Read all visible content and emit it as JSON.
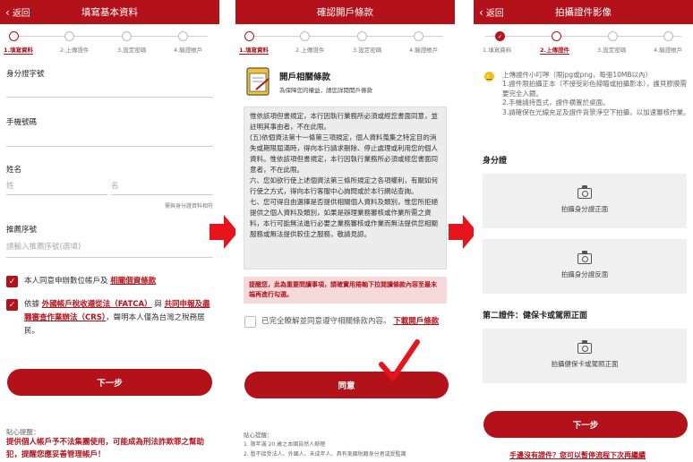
{
  "steps": [
    "1.填寫資料",
    "2.上傳證件",
    "3.設定密碼",
    "4.驗證帳戶"
  ],
  "p1": {
    "back": "返回",
    "title": "填寫基本資料",
    "id_label": "身分證字號",
    "phone_label": "手機號碼",
    "name_label": "姓名",
    "surname_ph": "姓",
    "given_ph": "名",
    "name_note": "需與身分證資料相符",
    "referral_label": "推薦序號",
    "referral_ph": "請輸入推薦序號(選填)",
    "agree1_text": "本人同意申辦數位帳戶及",
    "agree1_link": "相關個資條款",
    "agree2_pre": "依據",
    "agree2_link1": "外國帳戶稅收遵從法（FATCA）",
    "agree2_mid": "與",
    "agree2_link2": "共同申報及盡職審查作業辦法（CRS）",
    "agree2_post": "，聲明本人僅為台灣之稅務居民。",
    "next": "下一步",
    "tip_title": "貼心提醒：",
    "tip_text": "提供個人帳戶予不法集團使用，可能成為刑法詐欺罪之幫助犯，提醒您應妥善管理帳戶！"
  },
  "p2": {
    "title": "確認開戶條款",
    "section_title": "開戶相關條款",
    "section_sub": "為保障您的權益，請您詳閱開戶條款",
    "terms": "惟依該項但書規定，本行因執行業務所必須或經您書面同意，並註明其事由者，不在此限。\n(五)依個資法第十一條第三項規定，個人資料蒐集之特定目的消失或期限屆滿時，得向本行請求刪除、停止處理或利用您的個人資料。惟依該項但書規定，本行因執行業務所必須或經您書面同意者，不在此限。\n六、您如欲行使上述個資法第三條所規定之各項權利，有關如何行使之方式，得向本行客服中心詢問或於本行網站查詢。\n七、您可得自由選擇是否提供相關個人資料及類別，惟您所拒絕提供之個人資料及類別，如果是辦理業務審核或作業所需之資料，本行可能無法進行必要之業務審核或作業而無法提供您相關服務或無法提供較佳之服務，敬請見諒。",
    "warning": "提醒您，此為重要問讀事項，請確實用捲軸下拉閱讀條款內容至最末端再進行勾選。",
    "agree_text": "已完全瞭解並同意遵守相關條款內容。",
    "agree_link": "下載開戶條款",
    "agree_btn": "同意",
    "tip_title": "貼心提醒：",
    "tip1": "1. 限年滿 20 歲之本國自然人辦理",
    "tip2": "2. 暫不接受法人、外國人、未成年人、具有美國稅籍身分者或受監護"
  },
  "p3": {
    "back": "返回",
    "title": "拍攝證件影像",
    "notice_title": "上傳證件小叮嚀（限jpg或png，每張10MB以內）",
    "notice": "1.證件限拍攝正本（不接受彩色掃瞄或拍攝影本），護貝膠膜需要完全入鏡。\n2.手機請持直式，證件横置於桌面。\n3.請確保在光線充足及證件背景淨空下拍攝，以加速審核作業。",
    "id_section": "身分證",
    "id_front": "拍攝身分證正面",
    "id_back": "拍攝身分證反面",
    "second_section": "第二證件：健保卡或駕照正面",
    "second_front": "拍攝健保卡或駕照正面",
    "next": "下一步",
    "no_doc_link": "手邊沒有證件？您可以暫停流程下次再繼續"
  },
  "colors": {
    "brand": "#b4121b",
    "arrow": "#e8141c"
  }
}
